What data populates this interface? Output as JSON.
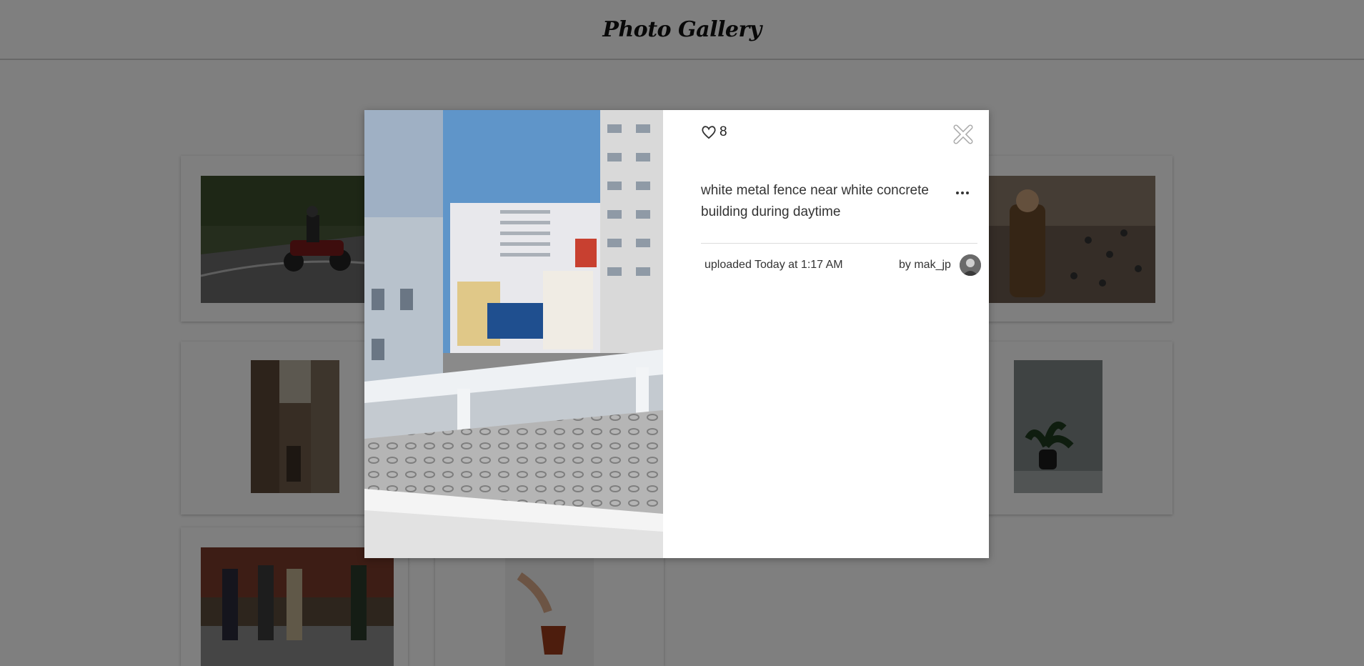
{
  "header": {
    "title": "Photo Gallery"
  },
  "gallery": {
    "cards": [
      {
        "alt": "motorcycle rider on road"
      },
      {
        "alt": "woman feeding pigeons"
      },
      {
        "alt": "narrow alley street"
      },
      {
        "alt": "potted plant"
      },
      {
        "alt": "people crossing street"
      },
      {
        "alt": "pouring tea"
      }
    ]
  },
  "modal": {
    "likes": "8",
    "description": "white metal fence near white concrete building during daytime",
    "uploaded": "uploaded Today at 1:17 AM",
    "author": "by mak_jp"
  },
  "colors": {
    "overlay": "#808080",
    "accent": "#333333"
  },
  "icons": {
    "like": "heart-outline-icon",
    "close": "close-icon",
    "more": "more-dots-icon"
  }
}
